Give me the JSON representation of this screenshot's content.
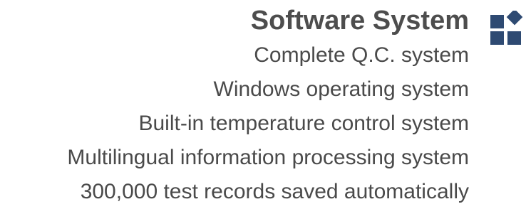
{
  "section": {
    "title": "Software System",
    "icon": "modules-icon",
    "icon_color": "#2e4a72",
    "features": [
      "Complete Q.C. system",
      "Windows operating system",
      "Built-in temperature control system",
      "Multilingual information processing system",
      "300,000 test records saved automatically"
    ]
  }
}
